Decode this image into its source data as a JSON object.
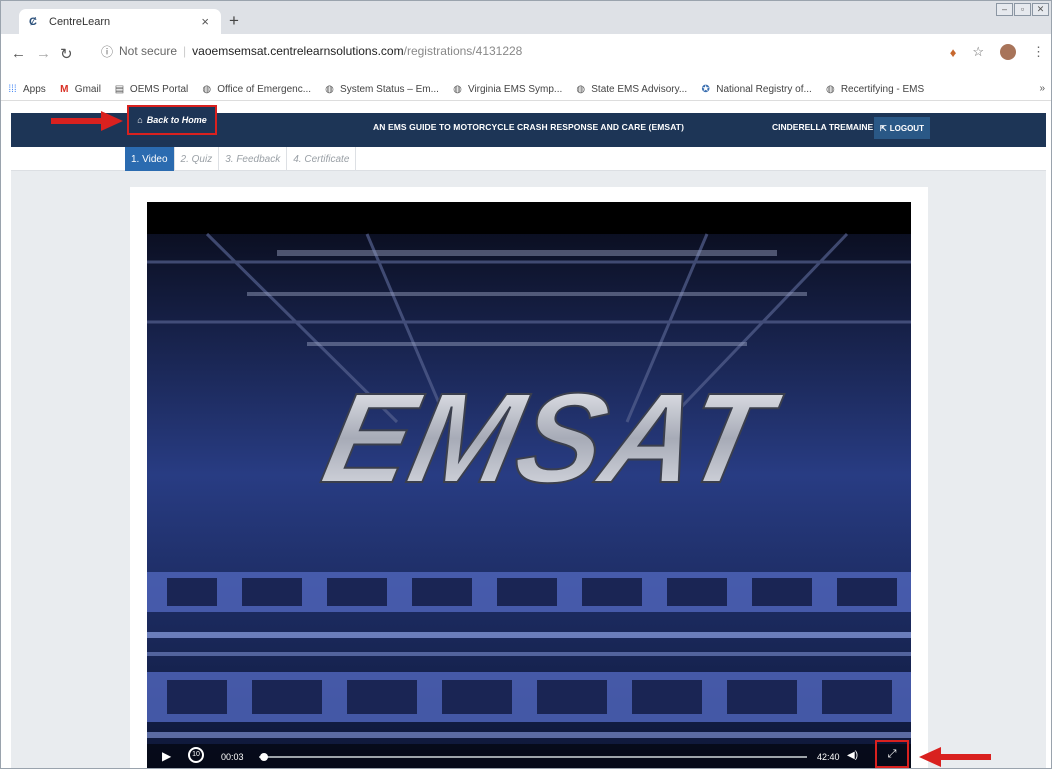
{
  "browser": {
    "tab_title": "CentreLearn",
    "tab_close": "×",
    "new_tab": "+",
    "url_security": "Not secure",
    "url_host": "vaoemsemsat.centrelearnsolutions.com",
    "url_path": "/registrations/4131228",
    "bookmarks": [
      {
        "label": "Apps",
        "icon": "apps-grid-icon"
      },
      {
        "label": "Gmail",
        "icon": "gmail-icon"
      },
      {
        "label": "OEMS Portal",
        "icon": "page-icon"
      },
      {
        "label": "Office of Emergenc...",
        "icon": "globe-icon"
      },
      {
        "label": "System Status – Em...",
        "icon": "globe-icon"
      },
      {
        "label": "Virginia EMS Symp...",
        "icon": "globe-icon"
      },
      {
        "label": "State EMS Advisory...",
        "icon": "globe-icon"
      },
      {
        "label": "National Registry of...",
        "icon": "registry-icon"
      },
      {
        "label": "Recertifying - EMS",
        "icon": "globe-icon"
      }
    ],
    "bookmarks_more": "»"
  },
  "site": {
    "back_home": "Back to Home",
    "course_title": "AN EMS GUIDE TO MOTORCYCLE CRASH RESPONSE AND CARE (EMSAT)",
    "user_name": "CINDERELLA TREMAINE",
    "logout": "LOGOUT",
    "steps": [
      "1. Video",
      "2. Quiz",
      "3. Feedback",
      "4. Certificate"
    ]
  },
  "video": {
    "title_text": "EMSAT",
    "current_time": "00:03",
    "duration": "42:40",
    "rewind_label": "10",
    "progress_fraction": 0.001
  },
  "colors": {
    "header_bg": "#1d3556",
    "step_active": "#2b6bb0",
    "highlight": "#d9211f"
  }
}
